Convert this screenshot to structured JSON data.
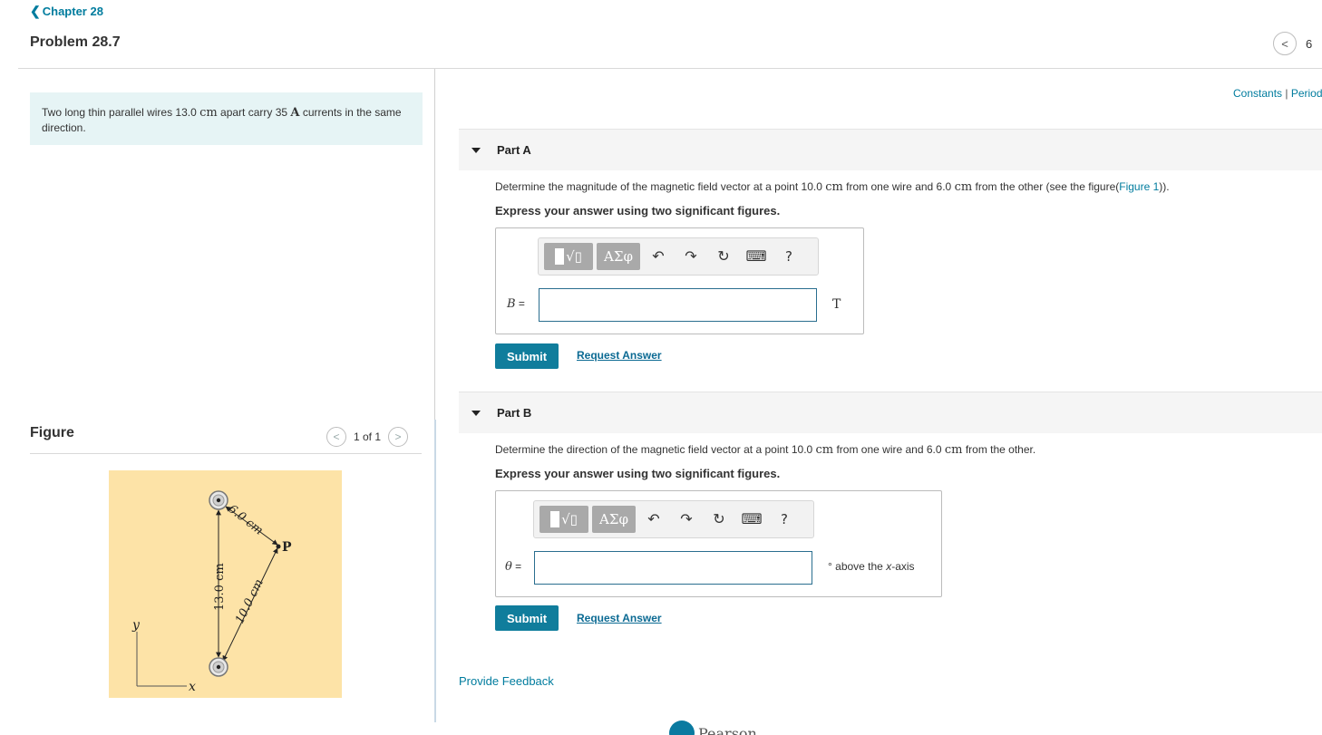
{
  "header": {
    "back_label": "Chapter 28",
    "problem_title": "Problem 28.7",
    "nav_prev_icon": "chevron-left-icon",
    "nav_count": "6"
  },
  "intro": {
    "t1": "Two long thin parallel wires 13.0 ",
    "u1": "cm",
    "t2": " apart carry 35 ",
    "u2": "A",
    "t3": " currents in the same direction."
  },
  "figure": {
    "title": "Figure",
    "pager": "1 of 1",
    "labels": {
      "d1": "6.0 cm",
      "d2": "10.0 cm",
      "sep": "13.0 cm",
      "point": "P",
      "y_axis": "y",
      "x_axis": "x"
    }
  },
  "links": {
    "constants": "Constants",
    "separator": " | ",
    "periodic": "Periodic Table",
    "provide_feedback": "Provide Feedback"
  },
  "part_a": {
    "label": "Part A",
    "q1": "Determine the magnitude of the magnetic field vector at a point 10.0 ",
    "u1": "cm",
    "q2": " from one wire and 6.0 ",
    "u2": "cm",
    "q3": " from the other (see the figure(",
    "fig_link": "Figure 1",
    "q4": ")).",
    "instruction": "Express your answer using two significant figures.",
    "variable": "B",
    "equals": " =",
    "unit": "T",
    "submit": "Submit",
    "request": "Request Answer"
  },
  "part_b": {
    "label": "Part B",
    "q1": "Determine the direction of the magnetic field vector at a point 10.0 ",
    "u1": "cm",
    "q2": " from one wire and 6.0 ",
    "u2": "cm",
    "q3": " from the other.",
    "instruction": "Express your answer using two significant figures.",
    "variable": "θ",
    "equals": " =",
    "unit_deg": "°",
    "unit_pre": " above the ",
    "unit_axis": "x",
    "unit_post": "-axis",
    "submit": "Submit",
    "request": "Request Answer"
  },
  "toolbar": {
    "greek": "ΑΣφ",
    "help": "?"
  },
  "footer": {
    "brand": "Pearson"
  }
}
